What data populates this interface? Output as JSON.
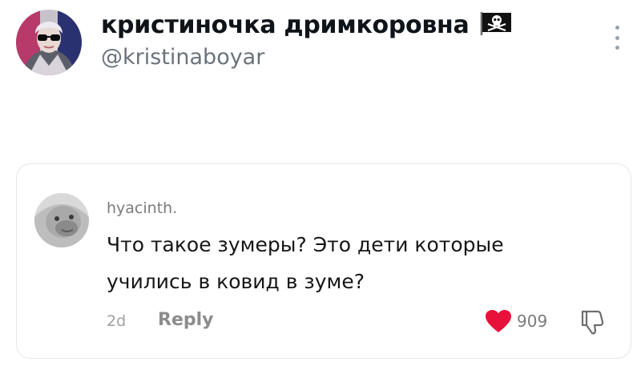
{
  "post": {
    "author": {
      "display_name": "кристиночка дримкоровна",
      "handle": "@kristinaboyar",
      "badge_icon": "pirate-flag-icon"
    },
    "more_icon": "more-vertical-icon"
  },
  "comment": {
    "username": "hyacinth.",
    "text": "Что такое зумеры? Это дети которые учились в ковид в зуме?",
    "time": "2d",
    "reply_label": "Reply",
    "like_count": "909",
    "like_icon": "heart-icon",
    "dislike_icon": "dislike-icon"
  },
  "colors": {
    "like_red": "#e8113c",
    "muted": "#8c8c8c",
    "card_border": "#e7e7e7"
  }
}
